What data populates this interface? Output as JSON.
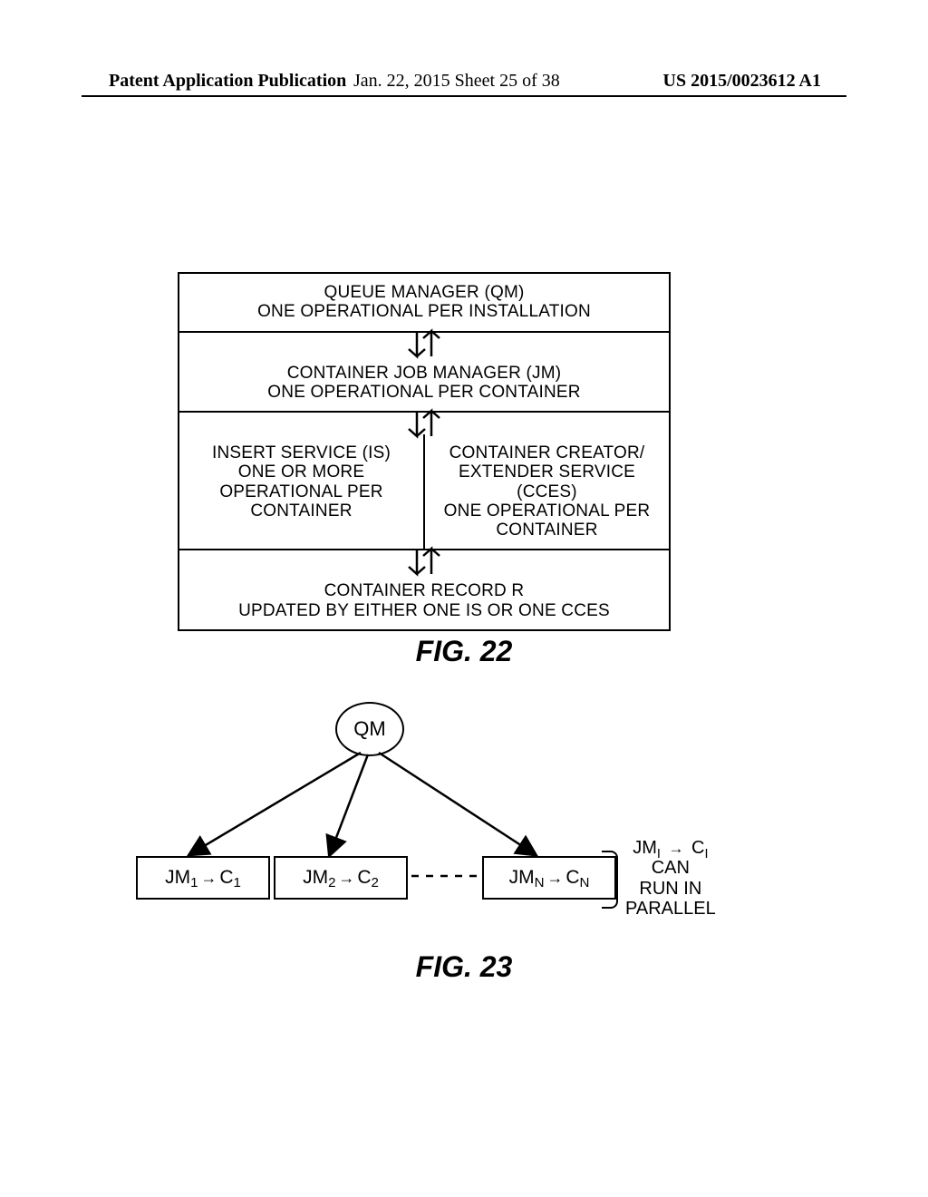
{
  "header": {
    "left": "Patent Application Publication",
    "middle": "Jan. 22, 2015  Sheet 25 of 38",
    "right": "US 2015/0023612 A1"
  },
  "fig22": {
    "qm_l1": "QUEUE MANAGER (QM)",
    "qm_l2": "ONE OPERATIONAL PER INSTALLATION",
    "jm_l1": "CONTAINER JOB MANAGER (JM)",
    "jm_l2": "ONE OPERATIONAL PER CONTAINER",
    "is_l1": "INSERT SERVICE (IS)",
    "is_l2": "ONE OR MORE",
    "is_l3": "OPERATIONAL PER",
    "is_l4": "CONTAINER",
    "cces_l1": "CONTAINER CREATOR/",
    "cces_l2": "EXTENDER SERVICE (CCES)",
    "cces_l3": "ONE OPERATIONAL PER",
    "cces_l4": "CONTAINER",
    "rec_l1": "CONTAINER RECORD R",
    "rec_l2": "UPDATED BY EITHER ONE IS OR ONE CCES",
    "caption": "FIG. 22"
  },
  "fig23": {
    "qm": "QM",
    "jm1": {
      "j": "JM",
      "js": "1",
      "c": "C",
      "cs": "1"
    },
    "jm2": {
      "j": "JM",
      "js": "2",
      "c": "C",
      "cs": "2"
    },
    "jmn": {
      "j": "JM",
      "js": "N",
      "c": "C",
      "cs": "N"
    },
    "annot_l1a": "JM",
    "annot_l1a_s": "I",
    "annot_l1b": "C",
    "annot_l1b_s": "I",
    "annot_l2": "CAN",
    "annot_l3": "RUN IN",
    "annot_l4": "PARALLEL",
    "caption": "FIG. 23"
  }
}
